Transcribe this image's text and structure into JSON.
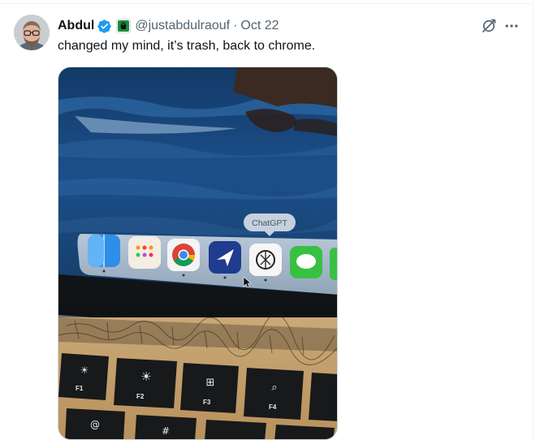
{
  "tweet": {
    "author_name": "Abdul",
    "handle": "@justabdulraouf",
    "separator": "·",
    "date": "Oct 22",
    "text": "changed my mind, it’s trash, back to chrome."
  },
  "media": {
    "tooltip": "ChatGPT",
    "dock_apps": [
      "finder-icon",
      "reminders-icon",
      "chrome-icon",
      "navigation-app-icon",
      "chatgpt-icon",
      "messages-icon"
    ],
    "keys": [
      {
        "label": "F1",
        "glyph": "☀"
      },
      {
        "label": "F2",
        "glyph": "☀"
      },
      {
        "label": "F3",
        "glyph": "⊞"
      },
      {
        "label": "F4",
        "glyph": "⌕"
      }
    ],
    "bottom_keys": [
      "@",
      "#"
    ]
  },
  "icons": {
    "verified": "verified-badge-icon",
    "affiliate": "affiliate-badge-icon",
    "grok": "grok-icon",
    "more": "more-icon"
  },
  "colors": {
    "verified_blue": "#1d9bf0",
    "affiliate_green": "#1a8c3a",
    "text_primary": "#0f1419",
    "text_secondary": "#536471"
  }
}
